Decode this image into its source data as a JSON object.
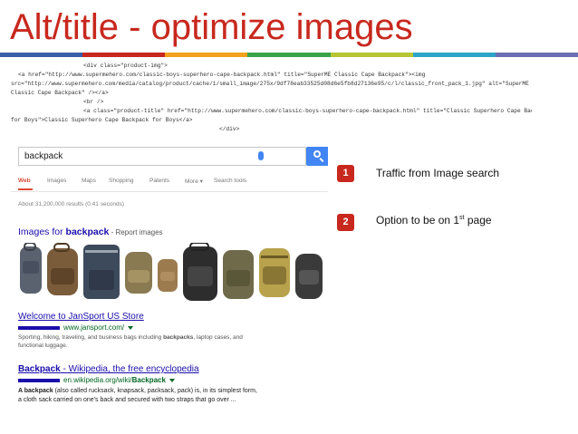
{
  "slide": {
    "title": "Alt/title - optimize images",
    "colorbar": [
      "#3b5ea8",
      "#c8281e",
      "#f2a21b",
      "#3aa34a",
      "#b7c632",
      "#2aa5c7",
      "#6c6fb3"
    ]
  },
  "code": {
    "lines": [
      "<div class=\"product-img\">",
      "  <a href=\"http://www.supermehero.com/classic-boys-superhero-cape-backpack.html\" title=\"SuperME Classic Cape Backpack\"><img",
      "src=\"http://www.supermehero.com/media/catalog/product/cache/1/small_image/275x/9df78eab33525d08d6e5fb8d27136e95/c/l/classic_front_pack_1.jpg\" alt=\"SuperME",
      "Classic Cape Backpack\" /></a>",
      "  <br />",
      "  <a class=\"product-title\" href=\"http://www.supermehero.com/classic-boys-superhero-cape-backpack.html\" title=\"Classic Superhero Cape Backpack",
      "for Boys\">Classic Superhero Cape Backpack for Boys</a>",
      "</div>"
    ]
  },
  "search": {
    "query": "backpack",
    "tabs": [
      "Web",
      "Images",
      "Maps",
      "Shopping",
      "Patents",
      "More ▾",
      "Search tools"
    ],
    "results_count": "About 31,200,000 results (0.41 seconds)",
    "images_heading_prefix": "Images for ",
    "images_heading_bold": "backpack",
    "images_heading_suffix": " - Report images",
    "thumb_colors": [
      "#5a6270",
      "#7a5b3a",
      "#3d4a5c",
      "#8a7a52",
      "#9c7b4f",
      "#2d2d2d",
      "#6f6a4a",
      "#b8a24c",
      "#3a3a3a"
    ],
    "results": [
      {
        "title": "Welcome to JanSport US Store",
        "url": "www.jansport.com/",
        "snippet_1": "Sporting, hiking, traveling, and business bags including ",
        "snippet_bold": "backpacks",
        "snippet_2": ", laptop cases, and",
        "snippet_3": "functional luggage."
      },
      {
        "title": "Backpack - Wikipedia, the free encyclopedia",
        "title_bold": "Backpack",
        "title_rest": " - Wikipedia, the free encyclopedia",
        "url": "en.wikipedia.org/wiki/",
        "url_bold": "Backpack",
        "snippet_bold": "A backpack",
        "snippet_1": " (also called rucksack, knapsack, packsack, pack) is, in its simplest form,",
        "snippet_2": "a cloth sack carried on one's back and secured with two straps that go over ..."
      }
    ]
  },
  "callouts": [
    {
      "number": "1",
      "text": "Traffic from Image search"
    },
    {
      "number": "2",
      "text_main": "Option to be on 1",
      "text_sup": "st",
      "text_end": " page"
    }
  ]
}
